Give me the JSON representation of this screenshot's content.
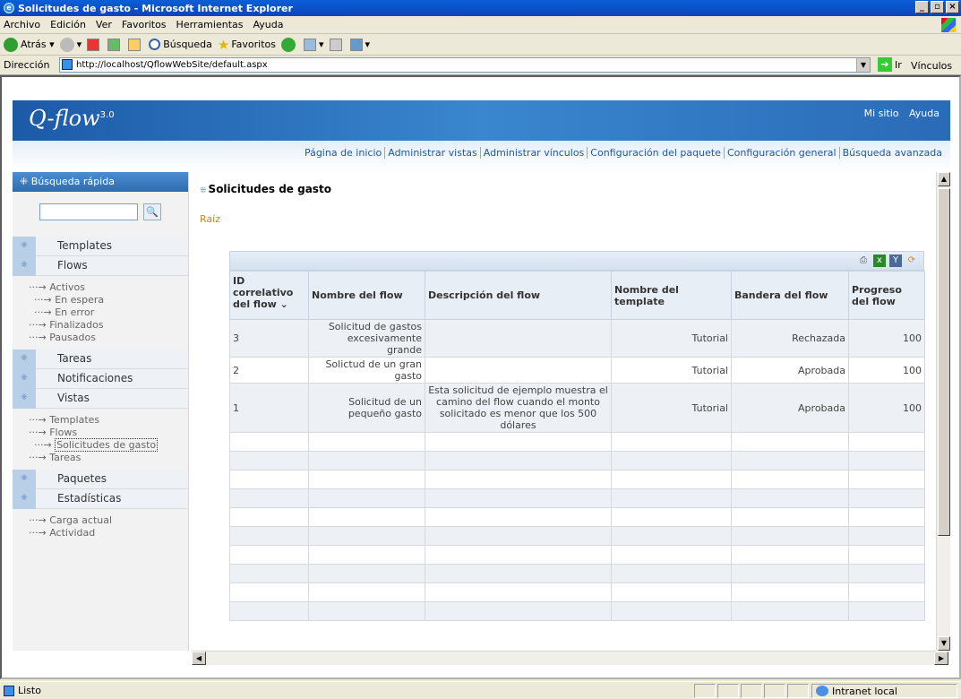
{
  "window": {
    "title": "Solicitudes de gasto - Microsoft Internet Explorer"
  },
  "menu": [
    "Archivo",
    "Edición",
    "Ver",
    "Favoritos",
    "Herramientas",
    "Ayuda"
  ],
  "toolbar": {
    "back": "Atrás",
    "search": "Búsqueda",
    "favorites": "Favoritos"
  },
  "address": {
    "label": "Dirección",
    "url": "http://localhost/QflowWebSite/default.aspx",
    "go": "Ir",
    "links": "Vínculos"
  },
  "site": {
    "logo": "Q-flow",
    "version": "3.0",
    "top_links": [
      "Mi sitio",
      "Ayuda"
    ],
    "nav": [
      "Página de inicio",
      "Administrar vistas",
      "Administrar vínculos",
      "Configuración del paquete",
      "Configuración general",
      "Búsqueda avanzada"
    ]
  },
  "sidebar": {
    "quick_search": "Búsqueda rápida",
    "templates": "Templates",
    "flows": "Flows",
    "flows_sub": {
      "activos": "Activos",
      "en_espera": "En espera",
      "en_error": "En error",
      "finalizados": "Finalizados",
      "pausados": "Pausados"
    },
    "tareas": "Tareas",
    "notificaciones": "Notificaciones",
    "vistas": "Vistas",
    "vistas_sub": {
      "templates": "Templates",
      "flows": "Flows",
      "solicitudes": "Solicitudes de gasto",
      "tareas": "Tareas"
    },
    "paquetes": "Paquetes",
    "estadisticas": "Estadísticas",
    "estadisticas_sub": {
      "carga": "Carga actual",
      "actividad": "Actividad"
    }
  },
  "main": {
    "title": "Solicitudes de gasto",
    "breadcrumb": "Raíz",
    "table": {
      "headers": {
        "id": "ID correlativo del flow",
        "sort_icon": "⌄",
        "name": "Nombre del flow",
        "desc": "Descripción del flow",
        "template": "Nombre del template",
        "flag": "Bandera del flow",
        "progress": "Progreso del flow"
      },
      "rows": [
        {
          "id": "3",
          "name": "Solicitud de gastos excesivamente grande",
          "desc": "",
          "template": "Tutorial",
          "flag": "Rechazada",
          "progress": "100"
        },
        {
          "id": "2",
          "name": "Solictud de un gran gasto",
          "desc": "",
          "template": "Tutorial",
          "flag": "Aprobada",
          "progress": "100"
        },
        {
          "id": "1",
          "name": "Solicitud de un pequeño gasto",
          "desc": "Esta solicitud de ejemplo muestra el camino del flow cuando el monto solicitado es menor que los 500 dólares",
          "template": "Tutorial",
          "flag": "Aprobada",
          "progress": "100"
        }
      ]
    }
  },
  "status": {
    "text": "Listo",
    "zone": "Intranet local"
  }
}
